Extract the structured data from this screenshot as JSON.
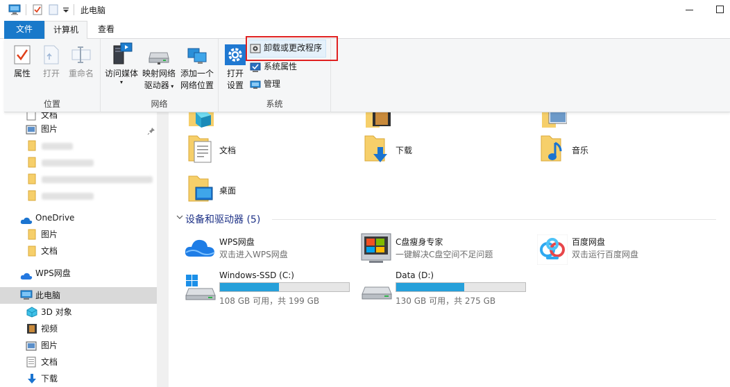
{
  "window": {
    "title": "此电脑"
  },
  "tabs": [
    {
      "label": "文件"
    },
    {
      "label": "计算机"
    },
    {
      "label": "查看"
    }
  ],
  "ribbon": {
    "groups": {
      "location": {
        "label": "位置",
        "properties": "属性",
        "open": "打开",
        "rename": "重命名"
      },
      "network": {
        "label": "网络",
        "access_media_l1": "访问媒体",
        "map_drive_l1": "映射网络",
        "map_drive_l2": "驱动器",
        "add_location_l1": "添加一个",
        "add_location_l2": "网络位置"
      },
      "system": {
        "label": "系统",
        "open_settings_l1": "打开",
        "open_settings_l2": "设置",
        "uninstall": "卸载或更改程序",
        "system_properties": "系统属性",
        "manage": "管理"
      }
    }
  },
  "nav": {
    "items": [
      {
        "label": "文档"
      },
      {
        "label": "图片"
      },
      {
        "label": "OneDrive"
      },
      {
        "label": "图片"
      },
      {
        "label": "文档"
      },
      {
        "label": "WPS网盘"
      },
      {
        "label": "此电脑"
      },
      {
        "label": "3D 对象"
      },
      {
        "label": "视频"
      },
      {
        "label": "图片"
      },
      {
        "label": "文档"
      },
      {
        "label": "下载"
      }
    ]
  },
  "folders": [
    {
      "label": "文档"
    },
    {
      "label": "下载"
    },
    {
      "label": "音乐"
    },
    {
      "label": "桌面"
    }
  ],
  "devices": {
    "header": "设备和驱动器 (5)",
    "apps": [
      {
        "title": "WPS网盘",
        "subtitle": "双击进入WPS网盘"
      },
      {
        "title": "C盘瘦身专家",
        "subtitle": "一键解决C盘空间不足问题"
      },
      {
        "title": "百度网盘",
        "subtitle": "双击运行百度网盘"
      }
    ],
    "drives": [
      {
        "title": "Windows-SSD (C:)",
        "usage": "108 GB 可用，共 199 GB",
        "used_fraction": 0.457
      },
      {
        "title": "Data (D:)",
        "usage": "130 GB 可用，共 275 GB",
        "used_fraction": 0.527
      }
    ]
  },
  "colors": {
    "accent": "#1979ca",
    "bar_fill": "#26a0da",
    "highlight_border": "#e02020",
    "section_header": "#1e3287"
  }
}
